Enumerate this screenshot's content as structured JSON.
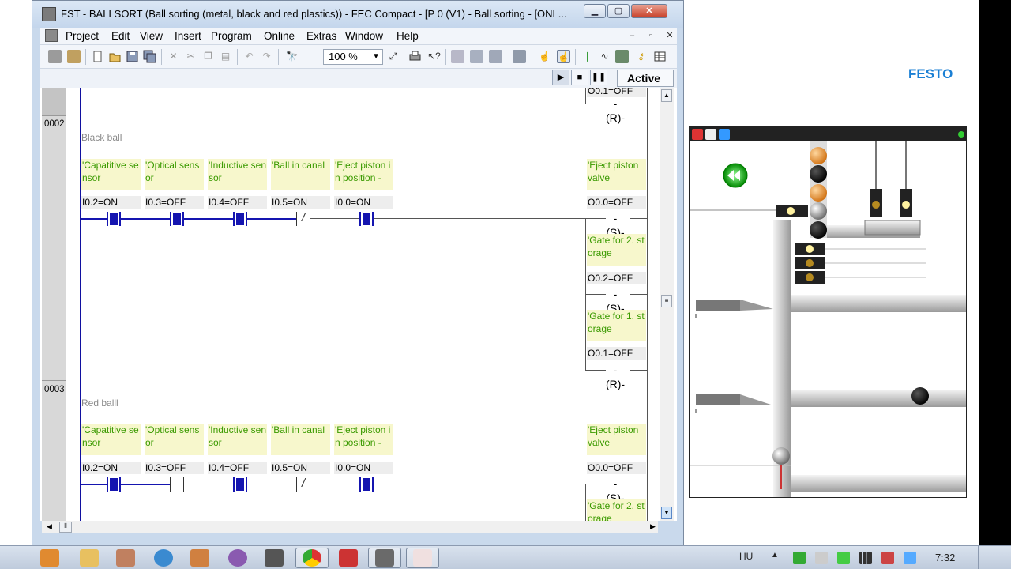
{
  "window": {
    "title": "FST - BALLSORT (Ball sorting (metal, black and red plastics)) - FEC Compact - [P  0 (V1) - Ball sorting - [ONL...",
    "min_label": "▁",
    "max_label": "▢",
    "close_label": "✕"
  },
  "menu": {
    "items": [
      "Project",
      "Edit",
      "View",
      "Insert",
      "Program",
      "Online",
      "Extras",
      "Window",
      "Help"
    ],
    "mdi_min": "–",
    "mdi_restore": "▫",
    "mdi_close": "✕"
  },
  "toolbar": {
    "zoom_value": "100 %",
    "icons": [
      "project-icon",
      "open-project-icon",
      "new-icon",
      "open-icon",
      "save-icon",
      "save-all-icon",
      "cut-icon",
      "cut2-icon",
      "copy-icon",
      "paste-icon",
      "undo-icon",
      "redo-icon",
      "find-icon",
      "zoom-tool-icon",
      "print-icon",
      "context-help-icon",
      "compile-icon",
      "build-icon",
      "download-icon",
      "online-icon",
      "online-toggle-icon",
      "contact-icon",
      "coil-icon",
      "module-icon",
      "variable-icon",
      "grid-icon"
    ]
  },
  "runbar": {
    "play": "▶",
    "stop": "■",
    "pause": "❚❚",
    "status": "Active"
  },
  "editor": {
    "top_partial": {
      "state": "O0.1=OFF",
      "coil": "-(R)-"
    },
    "rungs": [
      {
        "number": "0002",
        "title": "Black ball",
        "contacts": [
          {
            "comment": "'Capatitive sensor",
            "state": "I0.2=ON",
            "type": "no",
            "active": true
          },
          {
            "comment": "'Optical sensor",
            "state": "I0.3=OFF",
            "type": "nc",
            "active": true
          },
          {
            "comment": "'Inductive sensor",
            "state": "I0.4=OFF",
            "type": "nc",
            "active": true
          },
          {
            "comment": "'Ball in canal",
            "state": "I0.5=ON",
            "type": "nc",
            "active": false
          },
          {
            "comment": "'Eject piston in position -",
            "state": "I0.0=ON",
            "type": "no",
            "active": true
          }
        ],
        "outputs": [
          {
            "comment": "'Eject piston valve",
            "state": "O0.0=OFF",
            "coil": "-(S)-"
          },
          {
            "comment": "'Gate for 2. storage",
            "state": "O0.2=OFF",
            "coil": "-(S)-"
          },
          {
            "comment": "'Gate for 1. storage",
            "state": "O0.1=OFF",
            "coil": "-(R)-"
          }
        ]
      },
      {
        "number": "0003",
        "title": "Red balll",
        "contacts": [
          {
            "comment": "'Capatitive sensor",
            "state": "I0.2=ON",
            "type": "no",
            "active": true
          },
          {
            "comment": "'Optical sensor",
            "state": "I0.3=OFF",
            "type": "no",
            "active": false
          },
          {
            "comment": "'Inductive sensor",
            "state": "I0.4=OFF",
            "type": "nc",
            "active": true
          },
          {
            "comment": "'Ball in canal",
            "state": "I0.5=ON",
            "type": "nc",
            "active": false
          },
          {
            "comment": "'Eject piston in position -",
            "state": "I0.0=ON",
            "type": "no",
            "active": true
          }
        ],
        "outputs": [
          {
            "comment": "'Eject piston valve",
            "state": "O0.0=OFF",
            "coil": "-(S)-"
          },
          {
            "comment": "'Gate for 2. storage",
            "state": "",
            "coil": ""
          }
        ]
      }
    ]
  },
  "brand": {
    "logo": "FESTO"
  },
  "sim": {
    "led_color": "#33cc33"
  },
  "taskbar": {
    "apps": [
      "media-player-icon",
      "explorer-icon",
      "paint-icon",
      "ie-icon",
      "switch-icon",
      "viber-icon",
      "tool-icon",
      "chrome-icon",
      "pdf-icon",
      "fst-icon",
      "touch-icon"
    ],
    "language": "HU",
    "tray_arrow": "▲",
    "clock": "7:32"
  },
  "colors": {
    "active_contact": "#1515b0",
    "comment_text": "#3a9a00",
    "comment_bg": "#f7f7cc",
    "brand": "#1a7fd4"
  }
}
